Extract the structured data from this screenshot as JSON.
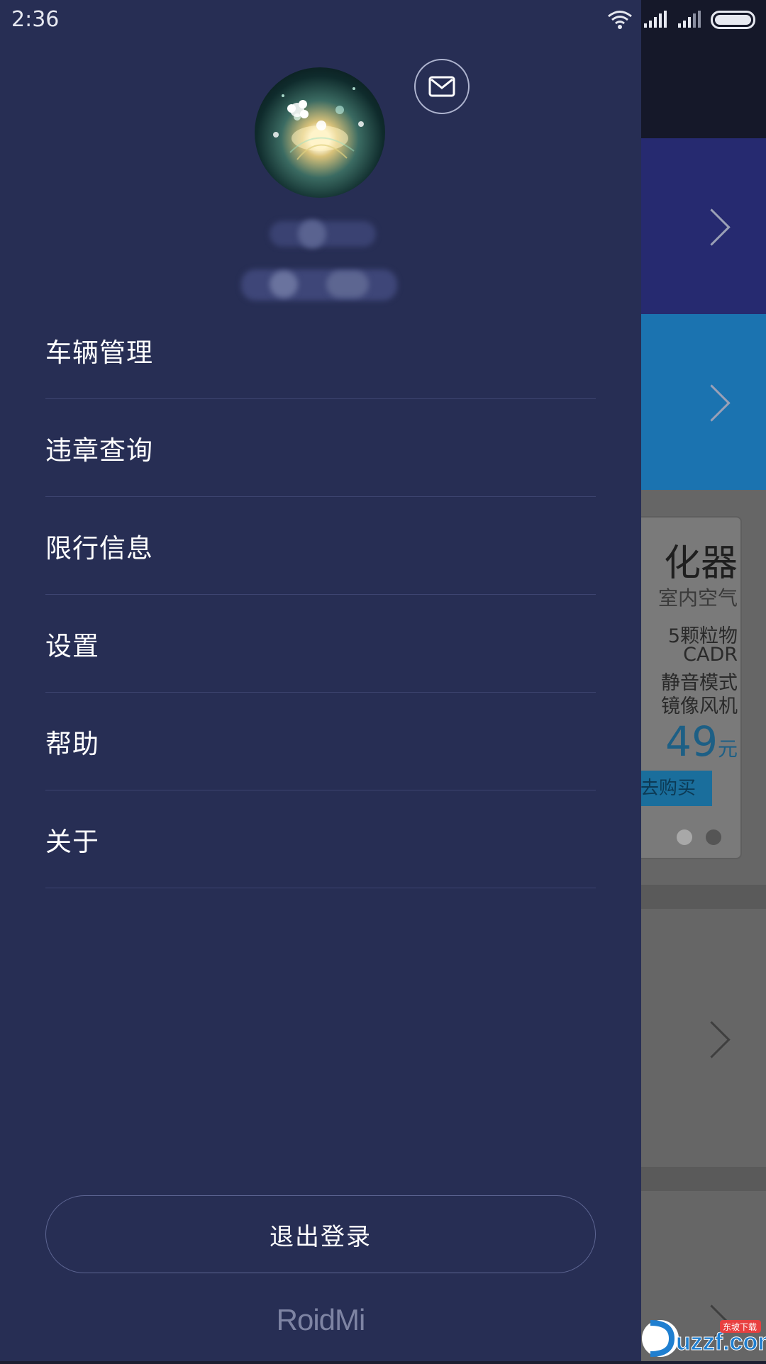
{
  "status_bar": {
    "time": "2:36"
  },
  "drawer": {
    "mail_icon": "mail-icon",
    "menu": [
      {
        "label": "车辆管理"
      },
      {
        "label": "违章查询"
      },
      {
        "label": "限行信息"
      },
      {
        "label": "设置"
      },
      {
        "label": "帮助"
      },
      {
        "label": "关于"
      }
    ],
    "logout_label": "退出登录",
    "brand": "RoidMi"
  },
  "background_app": {
    "ad": {
      "title": "化器",
      "subtitle": "室内空气",
      "features": [
        "5颗粒物",
        "CADR",
        "静音模式",
        "镜像风机"
      ],
      "price": "49",
      "price_unit": "元",
      "buy_label": "去购买"
    }
  },
  "watermark": {
    "text": "uzzf.com",
    "badge": "东坡下载"
  },
  "colors": {
    "drawer_bg": "#272e54",
    "divider": "#3d4470",
    "text": "#ffffff",
    "brand_text": "#7e84a3"
  }
}
